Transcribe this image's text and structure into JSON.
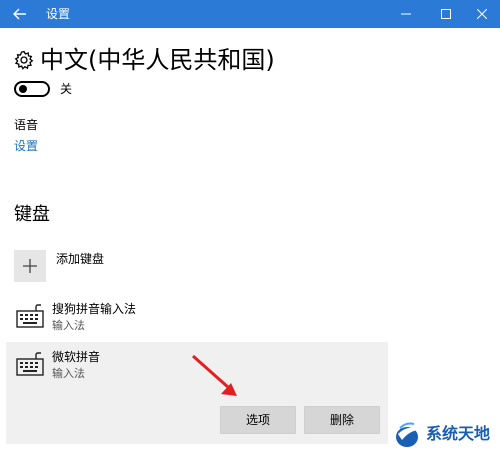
{
  "window": {
    "title": "设置",
    "back_icon": "back-arrow-icon",
    "controls": [
      "minimize-icon",
      "maximize-icon",
      "close-icon"
    ],
    "accent_color": "#2b7bd6"
  },
  "header": {
    "icon": "gear-icon",
    "title": "中文(中华人民共和国)"
  },
  "toggle": {
    "state": "off",
    "label": "关"
  },
  "voice": {
    "heading": "语音",
    "link": "设置",
    "link_color": "#1a6fc0"
  },
  "keyboards": {
    "heading": "键盘",
    "add_label": "添加键盘",
    "items": [
      {
        "name": "搜狗拼音输入法",
        "type": "输入法"
      },
      {
        "name": "微软拼音",
        "type": "输入法",
        "selected": true
      }
    ],
    "actions": {
      "options": "选项",
      "delete": "删除"
    }
  },
  "watermark": {
    "text": "系统天地"
  }
}
